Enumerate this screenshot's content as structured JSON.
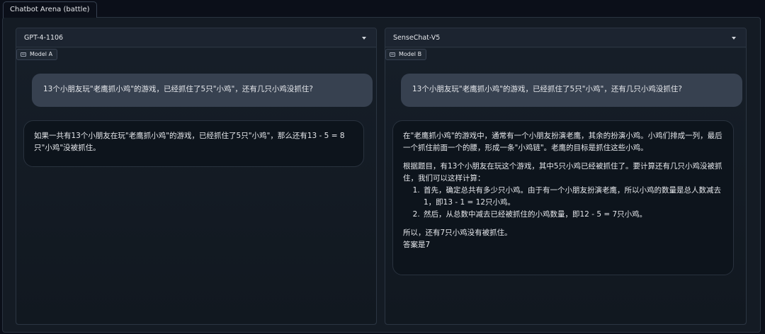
{
  "tab": {
    "label": "Chatbot Arena (battle)"
  },
  "model_a": {
    "dropdown_value": "GPT-4-1106",
    "label": "Model A",
    "messages": {
      "user": "13个小朋友玩\"老鹰抓小鸡\"的游戏，已经抓住了5只\"小鸡\"，还有几只小鸡没抓住?",
      "bot": "如果一共有13个小朋友在玩\"老鹰抓小鸡\"的游戏，已经抓住了5只\"小鸡\"，那么还有13 - 5 = 8只\"小鸡\"没被抓住。"
    }
  },
  "model_b": {
    "dropdown_value": "SenseChat-V5",
    "label": "Model B",
    "messages": {
      "user": "13个小朋友玩\"老鹰抓小鸡\"的游戏，已经抓住了5只\"小鸡\"，还有几只小鸡没抓住?",
      "bot": {
        "p1": "在\"老鹰抓小鸡\"的游戏中，通常有一个小朋友扮演老鹰，其余的扮演小鸡。小鸡们排成一列，最后一个抓住前面一个的腰，形成一条\"小鸡链\"。老鹰的目标是抓住这些小鸡。",
        "p2": "根据题目，有13个小朋友在玩这个游戏，其中5只小鸡已经被抓住了。要计算还有几只小鸡没被抓住，我们可以这样计算：",
        "steps": [
          "首先，确定总共有多少只小鸡。由于有一个小朋友扮演老鹰，所以小鸡的数量是总人数减去1，即13 - 1 = 12只小鸡。",
          "然后，从总数中减去已经被抓住的小鸡数量，即12 - 5 = 7只小鸡。"
        ],
        "p3": "所以，还有7只小鸡没有被抓住。",
        "p4": "答案是7"
      }
    }
  },
  "colors": {
    "background": "#0b0f19",
    "user_bubble": "#374150",
    "bot_bubble": "#0d141c"
  },
  "icons": {
    "model_label": "chat-icon",
    "dropdown": "chevron-down-icon"
  }
}
